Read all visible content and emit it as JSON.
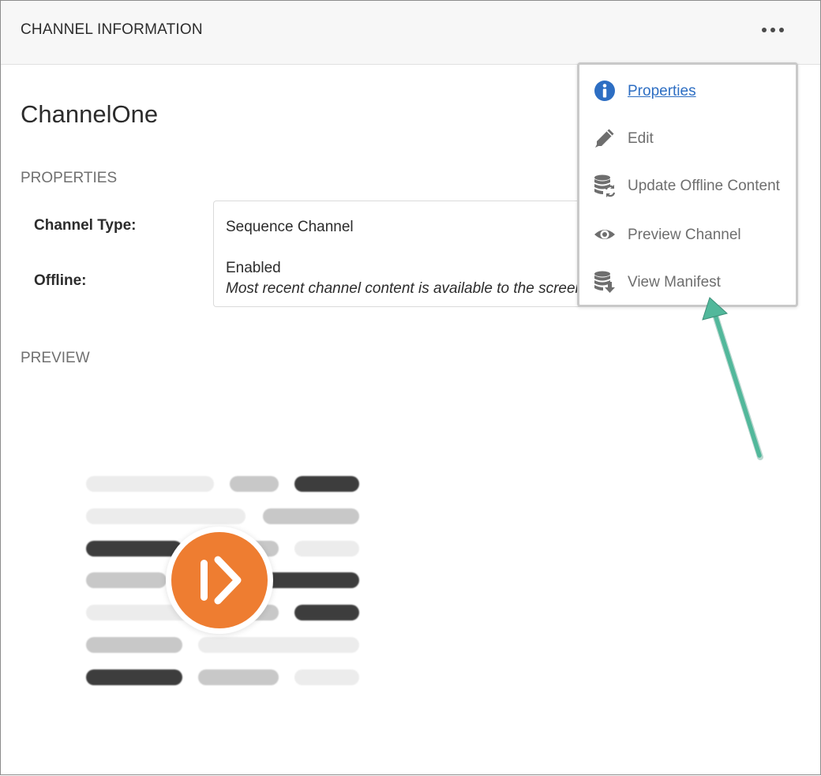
{
  "header": {
    "title": "CHANNEL INFORMATION"
  },
  "channel": {
    "name": "ChannelOne"
  },
  "properties": {
    "section_label": "PROPERTIES",
    "channel_type_label": "Channel Type:",
    "channel_type_value": "Sequence Channel",
    "offline_label": "Offline:",
    "offline_value": "Enabled",
    "offline_description": "Most recent channel content is available to the screens."
  },
  "preview": {
    "section_label": "PREVIEW"
  },
  "menu": {
    "items": [
      {
        "label": "Properties",
        "icon": "info-icon",
        "active": true
      },
      {
        "label": "Edit",
        "icon": "pencil-icon"
      },
      {
        "label": "Update Offline Content",
        "icon": "database-sync-icon"
      },
      {
        "label": "Preview Channel",
        "icon": "eye-icon"
      },
      {
        "label": "View Manifest",
        "icon": "database-download-icon"
      }
    ]
  },
  "colors": {
    "accent_link": "#2d6ec3",
    "info_icon": "#2d6ec3",
    "annotation_arrow": "#52b89b",
    "preview_orange": "#ee7d31",
    "dark_bar": "#3d3d3d"
  }
}
